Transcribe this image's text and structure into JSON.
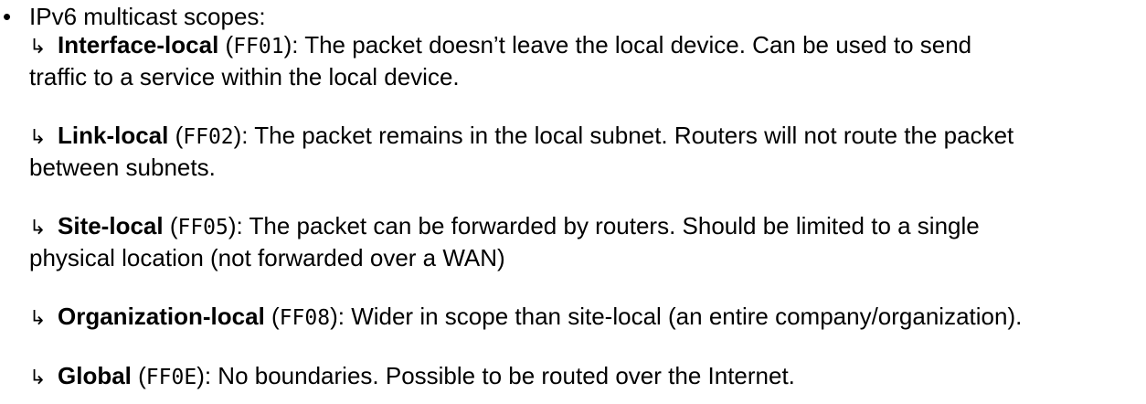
{
  "bullet": "•",
  "heading": "IPv6 multicast scopes:",
  "arrow": "↳",
  "scopes": [
    {
      "name": "Interface-local",
      "code": "FF01",
      "line1": "): The packet doesn’t leave the local device.  Can be used to send",
      "line2": "traffic to a service within the local device."
    },
    {
      "name": "Link-local",
      "code": "FF02",
      "line1": "): The packet remains in the local subnet.  Routers will not route the packet",
      "line2": "between subnets."
    },
    {
      "name": "Site-local",
      "code": "FF05",
      "line1": "): The packet can be forwarded by routers.  Should be limited to a single",
      "line2": "physical location (not forwarded over a WAN)"
    },
    {
      "name": "Organization-local",
      "code": "FF08",
      "line1": "): Wider in scope than site-local (an entire company/organization)."
    },
    {
      "name": "Global",
      "code": "FF0E",
      "line1": "): No boundaries.  Possible to be routed over the Internet."
    }
  ]
}
